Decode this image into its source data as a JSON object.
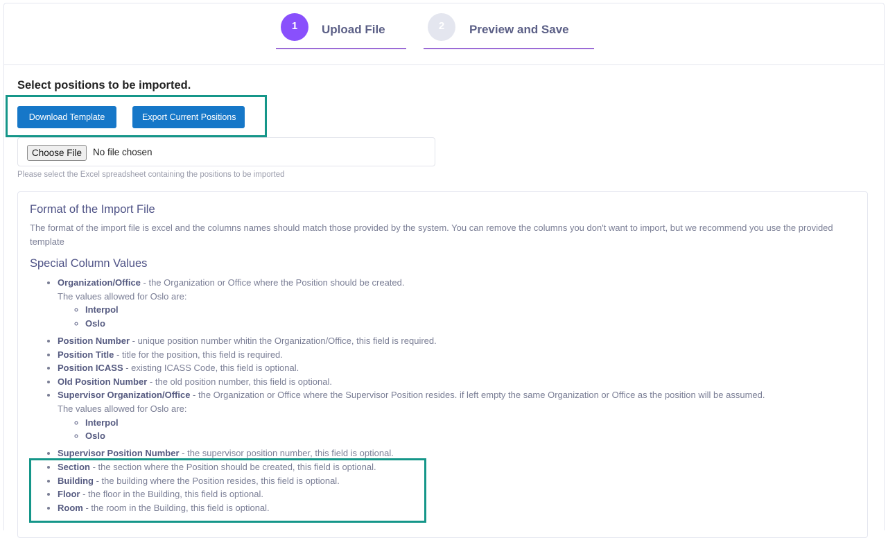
{
  "steps": [
    {
      "number": "1",
      "title": "Upload File",
      "state": "active",
      "color": "#8950fc"
    },
    {
      "number": "2",
      "title": "Preview and Save",
      "state": "inactive",
      "color": "#e4e6ef"
    }
  ],
  "page": {
    "heading": "Select positions to be imported."
  },
  "buttons": {
    "download_template": "Download Template",
    "export_positions": "Export Current Positions"
  },
  "file_input": {
    "button_label": "Choose File",
    "status": "No file chosen",
    "help": "Please select the Excel spreadsheet containing the positions to be imported"
  },
  "format": {
    "heading": "Format of the Import File",
    "description": "The format of the import file is excel and the columns names should match those provided by the system. You can remove the columns you don't want to import, but we recommend you use the provided template"
  },
  "special": {
    "heading": "Special Column Values",
    "items": [
      {
        "name": "Organization/Office",
        "desc": " - the Organization or Office where the Position should be created.",
        "allowed_label": "The values allowed for Oslo are:",
        "values": [
          "Interpol",
          "Oslo"
        ]
      },
      {
        "name": "Position Number",
        "desc": " - unique position number whitin the Organization/Office, this field is required."
      },
      {
        "name": "Position Title",
        "desc": " - title for the position, this field is required."
      },
      {
        "name": "Position ICASS",
        "desc": " - existing ICASS Code, this field is optional."
      },
      {
        "name": "Old Position Number",
        "desc": " - the old position number, this field is optional."
      },
      {
        "name": "Supervisor Organization/Office",
        "desc": " - the Organization or Office where the Supervisor Position resides. if left empty the same Organization or Office as the position will be assumed.",
        "allowed_label": "The values allowed for Oslo are:",
        "values": [
          "Interpol",
          "Oslo"
        ]
      },
      {
        "name": "Supervisor Position Number",
        "desc": " - the supervisor position number, this field is optional."
      },
      {
        "name": "Section",
        "desc": " - the section where the Position should be created, this field is optional."
      },
      {
        "name": "Building",
        "desc": " - the building where the Position resides, this field is optional."
      },
      {
        "name": "Floor",
        "desc": " - the floor in the Building, this field is optional."
      },
      {
        "name": "Room",
        "desc": " - the room in the Building, this field is optional."
      }
    ]
  },
  "colors": {
    "primary_button": "#1677c8",
    "highlight": "#159689",
    "step_underline": "#9b6bd6"
  }
}
